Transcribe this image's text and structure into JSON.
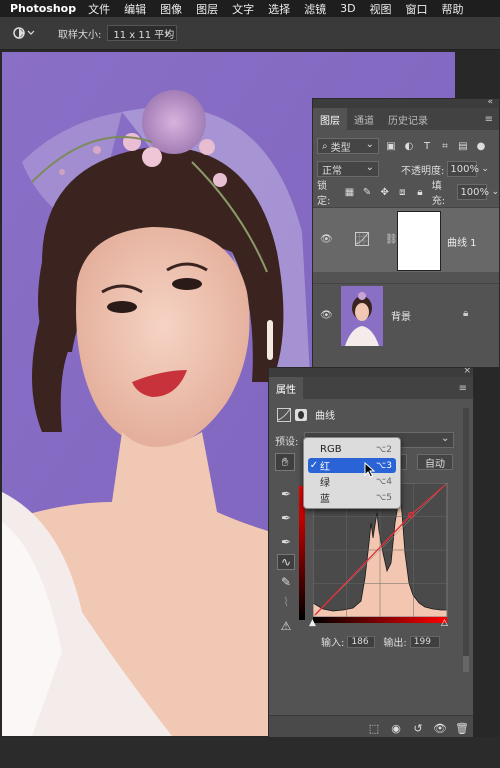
{
  "menubar": {
    "app": "Photoshop",
    "items": [
      "文件",
      "编辑",
      "图像",
      "图层",
      "文字",
      "选择",
      "滤镜",
      "3D",
      "视图",
      "窗口",
      "帮助"
    ]
  },
  "optionsbar": {
    "tool_icon": "eyedropper-target-icon",
    "sample_label": "取样大小:",
    "sample_value": "11 x 11 平均"
  },
  "layers_panel": {
    "tabs": [
      "图层",
      "通道",
      "历史记录"
    ],
    "filter_label": "类型",
    "blend_mode": "正常",
    "opacity_label": "不透明度:",
    "opacity_value": "100%",
    "lock_label": "锁定:",
    "fill_label": "填充:",
    "fill_value": "100%",
    "layers": [
      {
        "name": "曲线 1",
        "type": "adjustment"
      },
      {
        "name": "背景",
        "type": "image",
        "locked": true
      }
    ]
  },
  "properties_panel": {
    "title": "属性",
    "adjustment_name": "曲线",
    "preset_label": "预设:",
    "auto_button": "自动",
    "channel_options": [
      {
        "label": "RGB",
        "shortcut": "⌥2",
        "selected": false
      },
      {
        "label": "红",
        "shortcut": "⌥3",
        "selected": true
      },
      {
        "label": "绿",
        "shortcut": "⌥4",
        "selected": false
      },
      {
        "label": "蓝",
        "shortcut": "⌥5",
        "selected": false
      }
    ],
    "input_label": "输入:",
    "input_value": "186",
    "output_label": "输出:",
    "output_value": "199"
  },
  "colors": {
    "canvas_bg": "#8a72c6",
    "curve_line": "#e0303a",
    "histogram": "#f2c6b0",
    "selection": "#2a63d6"
  }
}
